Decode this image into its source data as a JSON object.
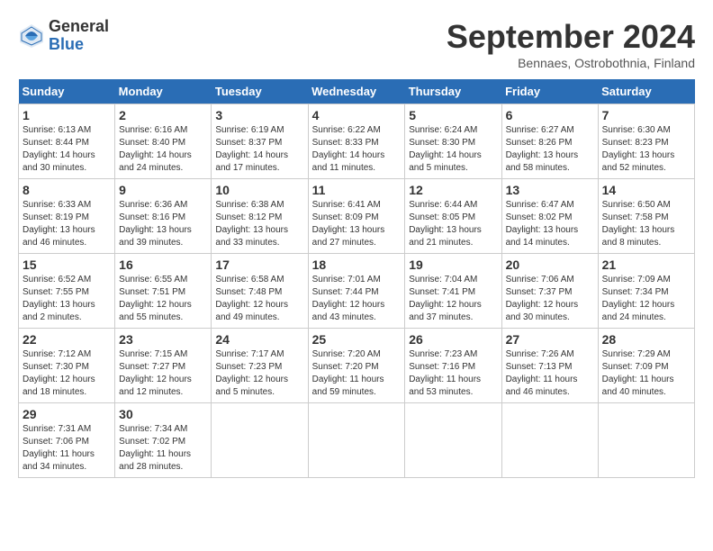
{
  "logo": {
    "general": "General",
    "blue": "Blue"
  },
  "title": "September 2024",
  "subtitle": "Bennaes, Ostrobothnia, Finland",
  "days_header": [
    "Sunday",
    "Monday",
    "Tuesday",
    "Wednesday",
    "Thursday",
    "Friday",
    "Saturday"
  ],
  "weeks": [
    [
      {
        "day": "1",
        "sunrise": "6:13 AM",
        "sunset": "8:44 PM",
        "daylight": "14 hours and 30 minutes."
      },
      {
        "day": "2",
        "sunrise": "6:16 AM",
        "sunset": "8:40 PM",
        "daylight": "14 hours and 24 minutes."
      },
      {
        "day": "3",
        "sunrise": "6:19 AM",
        "sunset": "8:37 PM",
        "daylight": "14 hours and 17 minutes."
      },
      {
        "day": "4",
        "sunrise": "6:22 AM",
        "sunset": "8:33 PM",
        "daylight": "14 hours and 11 minutes."
      },
      {
        "day": "5",
        "sunrise": "6:24 AM",
        "sunset": "8:30 PM",
        "daylight": "14 hours and 5 minutes."
      },
      {
        "day": "6",
        "sunrise": "6:27 AM",
        "sunset": "8:26 PM",
        "daylight": "13 hours and 58 minutes."
      },
      {
        "day": "7",
        "sunrise": "6:30 AM",
        "sunset": "8:23 PM",
        "daylight": "13 hours and 52 minutes."
      }
    ],
    [
      {
        "day": "8",
        "sunrise": "6:33 AM",
        "sunset": "8:19 PM",
        "daylight": "13 hours and 46 minutes."
      },
      {
        "day": "9",
        "sunrise": "6:36 AM",
        "sunset": "8:16 PM",
        "daylight": "13 hours and 39 minutes."
      },
      {
        "day": "10",
        "sunrise": "6:38 AM",
        "sunset": "8:12 PM",
        "daylight": "13 hours and 33 minutes."
      },
      {
        "day": "11",
        "sunrise": "6:41 AM",
        "sunset": "8:09 PM",
        "daylight": "13 hours and 27 minutes."
      },
      {
        "day": "12",
        "sunrise": "6:44 AM",
        "sunset": "8:05 PM",
        "daylight": "13 hours and 21 minutes."
      },
      {
        "day": "13",
        "sunrise": "6:47 AM",
        "sunset": "8:02 PM",
        "daylight": "13 hours and 14 minutes."
      },
      {
        "day": "14",
        "sunrise": "6:50 AM",
        "sunset": "7:58 PM",
        "daylight": "13 hours and 8 minutes."
      }
    ],
    [
      {
        "day": "15",
        "sunrise": "6:52 AM",
        "sunset": "7:55 PM",
        "daylight": "13 hours and 2 minutes."
      },
      {
        "day": "16",
        "sunrise": "6:55 AM",
        "sunset": "7:51 PM",
        "daylight": "12 hours and 55 minutes."
      },
      {
        "day": "17",
        "sunrise": "6:58 AM",
        "sunset": "7:48 PM",
        "daylight": "12 hours and 49 minutes."
      },
      {
        "day": "18",
        "sunrise": "7:01 AM",
        "sunset": "7:44 PM",
        "daylight": "12 hours and 43 minutes."
      },
      {
        "day": "19",
        "sunrise": "7:04 AM",
        "sunset": "7:41 PM",
        "daylight": "12 hours and 37 minutes."
      },
      {
        "day": "20",
        "sunrise": "7:06 AM",
        "sunset": "7:37 PM",
        "daylight": "12 hours and 30 minutes."
      },
      {
        "day": "21",
        "sunrise": "7:09 AM",
        "sunset": "7:34 PM",
        "daylight": "12 hours and 24 minutes."
      }
    ],
    [
      {
        "day": "22",
        "sunrise": "7:12 AM",
        "sunset": "7:30 PM",
        "daylight": "12 hours and 18 minutes."
      },
      {
        "day": "23",
        "sunrise": "7:15 AM",
        "sunset": "7:27 PM",
        "daylight": "12 hours and 12 minutes."
      },
      {
        "day": "24",
        "sunrise": "7:17 AM",
        "sunset": "7:23 PM",
        "daylight": "12 hours and 5 minutes."
      },
      {
        "day": "25",
        "sunrise": "7:20 AM",
        "sunset": "7:20 PM",
        "daylight": "11 hours and 59 minutes."
      },
      {
        "day": "26",
        "sunrise": "7:23 AM",
        "sunset": "7:16 PM",
        "daylight": "11 hours and 53 minutes."
      },
      {
        "day": "27",
        "sunrise": "7:26 AM",
        "sunset": "7:13 PM",
        "daylight": "11 hours and 46 minutes."
      },
      {
        "day": "28",
        "sunrise": "7:29 AM",
        "sunset": "7:09 PM",
        "daylight": "11 hours and 40 minutes."
      }
    ],
    [
      {
        "day": "29",
        "sunrise": "7:31 AM",
        "sunset": "7:06 PM",
        "daylight": "11 hours and 34 minutes."
      },
      {
        "day": "30",
        "sunrise": "7:34 AM",
        "sunset": "7:02 PM",
        "daylight": "11 hours and 28 minutes."
      },
      null,
      null,
      null,
      null,
      null
    ]
  ]
}
